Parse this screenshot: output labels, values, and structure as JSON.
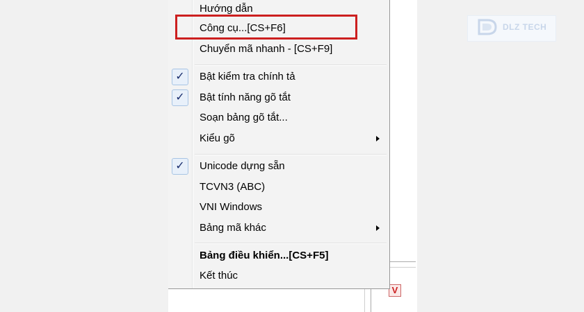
{
  "menu": {
    "items": [
      {
        "label": "Hướng dẫn",
        "checked": false,
        "submenu": false,
        "bold": false
      },
      {
        "label": "Công cụ...[CS+F6]",
        "checked": false,
        "submenu": false,
        "bold": false,
        "highlighted": true
      },
      {
        "label": "Chuyển mã nhanh - [CS+F9]",
        "checked": false,
        "submenu": false,
        "bold": false
      },
      {
        "label": "Bật kiểm tra chính tả",
        "checked": true,
        "submenu": false,
        "bold": false
      },
      {
        "label": "Bật tính năng gõ tắt",
        "checked": true,
        "submenu": false,
        "bold": false
      },
      {
        "label": "Soạn bảng gõ tắt...",
        "checked": false,
        "submenu": false,
        "bold": false
      },
      {
        "label": "Kiểu gõ",
        "checked": false,
        "submenu": true,
        "bold": false
      },
      {
        "label": "Unicode dựng sẵn",
        "checked": true,
        "submenu": false,
        "bold": false
      },
      {
        "label": "TCVN3 (ABC)",
        "checked": false,
        "submenu": false,
        "bold": false
      },
      {
        "label": "VNI Windows",
        "checked": false,
        "submenu": false,
        "bold": false
      },
      {
        "label": "Bảng mã khác",
        "checked": false,
        "submenu": true,
        "bold": false
      },
      {
        "label": "Bảng điều khiển...[CS+F5]",
        "checked": false,
        "submenu": false,
        "bold": true
      },
      {
        "label": "Kết thúc",
        "checked": false,
        "submenu": false,
        "bold": false
      }
    ],
    "check_glyph": "✓",
    "highlight_color": "#cc1f1f"
  },
  "watermark": {
    "text": "DLZ TECH",
    "icon": "dlz-logo-icon"
  },
  "tray": {
    "icon": "vietkey-tray-icon",
    "glyph": "V"
  }
}
